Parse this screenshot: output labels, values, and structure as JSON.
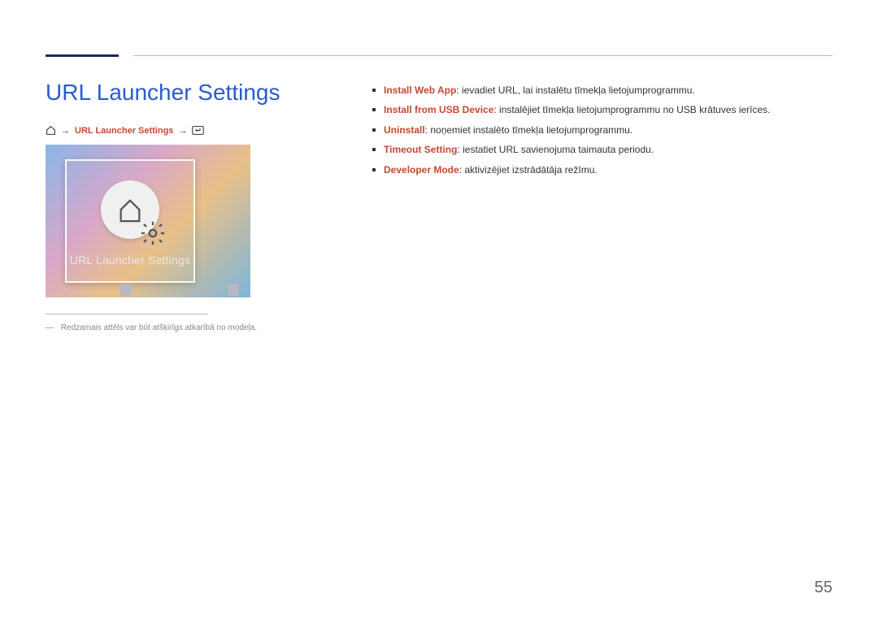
{
  "title": "URL Launcher Settings",
  "breadcrumb": {
    "link": "URL Launcher Settings"
  },
  "tile": {
    "label": "URL Launcher Settings"
  },
  "footnote": "Redzamais attēls var būt atšķirīgs atkarībā no modeļa.",
  "bullets": [
    {
      "key": "Install Web App",
      "desc": ": ievadiet URL, lai instalētu tīmekļa lietojumprogrammu."
    },
    {
      "key": "Install from USB Device",
      "desc": ": instalējiet tīmekļa lietojumprogrammu no USB krātuves ierīces."
    },
    {
      "key": "Uninstall",
      "desc": ": noņemiet instalēto tīmekļa lietojumprogrammu."
    },
    {
      "key": "Timeout Setting",
      "desc": ": iestatiet URL savienojuma taimauta periodu."
    },
    {
      "key": "Developer Mode",
      "desc": ": aktivizējiet izstrādātāja režīmu."
    }
  ],
  "pageNumber": "55"
}
